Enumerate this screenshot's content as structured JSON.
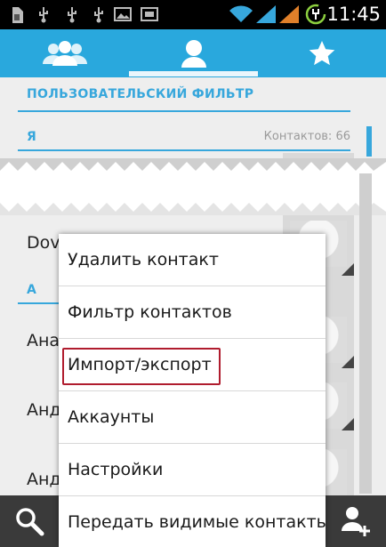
{
  "status_bar": {
    "time": "11:45",
    "left_icons": [
      "sim-card-icon",
      "usb-icon",
      "usb-icon",
      "usb-icon",
      "image-icon",
      "screenshot-icon"
    ],
    "right_icons": [
      "wifi-icon",
      "signal-icon",
      "signal-icon",
      "battery-charging-icon"
    ]
  },
  "tabs": [
    {
      "name": "groups",
      "icon": "groups-icon"
    },
    {
      "name": "contacts",
      "icon": "person-icon",
      "selected": true
    },
    {
      "name": "favorites",
      "icon": "star-icon"
    }
  ],
  "list": {
    "filter_header": "ПОЛЬЗОВАТЕЛЬСКИЙ ФИЛЬТР",
    "section_ya": "Я",
    "contact_count": "Контактов: 66",
    "section_a": "А",
    "contacts": [
      "Dov",
      "Ана",
      "Анд",
      "Анд"
    ]
  },
  "menu": {
    "items": [
      "Удалить контакт",
      "Фильтр контактов",
      "Импорт/экспорт",
      "Аккаунты",
      "Настройки",
      "Передать видимые контакты"
    ],
    "highlighted": "Импорт/экспорт"
  },
  "bottom_bar": {
    "left_icon": "search-icon",
    "right_icon": "add-contact-icon"
  },
  "colors": {
    "accent": "#29a8dd",
    "highlight_border": "#b01c2e"
  }
}
